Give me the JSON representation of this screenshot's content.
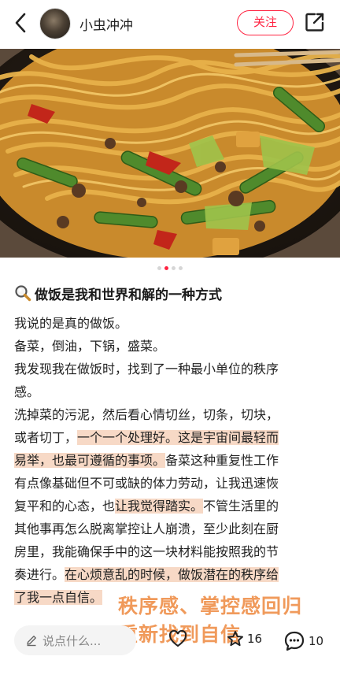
{
  "header": {
    "username": "小虫冲冲",
    "follow_label": "关注"
  },
  "carousel": {
    "total_images": 4,
    "active_index": 1
  },
  "post": {
    "title": "做饭是我和世界和解的一种方式",
    "lines": [
      [
        {
          "t": "我说的是真的做饭。",
          "hl": false
        }
      ],
      [
        {
          "t": "备菜，倒油，下锅，盛菜。",
          "hl": false
        }
      ],
      [
        {
          "t": "我发现我在做饭时，找到了一种最小单位的秩序",
          "hl": false
        }
      ],
      [
        {
          "t": "感。",
          "hl": false
        }
      ],
      [
        {
          "t": "洗掉菜的污泥，然后看心情切丝，切条，切块，",
          "hl": false
        }
      ],
      [
        {
          "t": "或者切丁，",
          "hl": false
        },
        {
          "t": "一个一个处理好。这是宇宙间最轻而",
          "hl": true
        }
      ],
      [
        {
          "t": "易举，也最可遵循的事项。",
          "hl": true
        },
        {
          "t": "备菜这种重复性工作",
          "hl": false
        }
      ],
      [
        {
          "t": "有点像基础但不可或缺的体力劳动，让我迅速恢",
          "hl": false
        }
      ],
      [
        {
          "t": "复平和的心态，也",
          "hl": false
        },
        {
          "t": "让我觉得踏实。",
          "hl": true
        },
        {
          "t": "不管生活里的",
          "hl": false
        }
      ],
      [
        {
          "t": "其他事再怎么脱离掌控让人崩溃，至少此刻在厨",
          "hl": false
        }
      ],
      [
        {
          "t": "房里，我能确保手中的这一块材料能按照我的节",
          "hl": false
        }
      ],
      [
        {
          "t": "奏进行。",
          "hl": false
        },
        {
          "t": "在心烦意乱的时候，做饭潜在的秩序给",
          "hl": true
        }
      ],
      [
        {
          "t": "了我一点自信。",
          "hl": true
        }
      ]
    ]
  },
  "overlay": {
    "line1": "秩序感、掌控感回归",
    "line2": "重新找到自信"
  },
  "bottom_bar": {
    "comment_placeholder": "说点什么...",
    "like_count": "",
    "collect_count": "16",
    "comment_count": "10"
  },
  "colors": {
    "accent": "#ff2442",
    "highlight": "#f7d9c6",
    "overlay_text": "#f09a5b"
  }
}
